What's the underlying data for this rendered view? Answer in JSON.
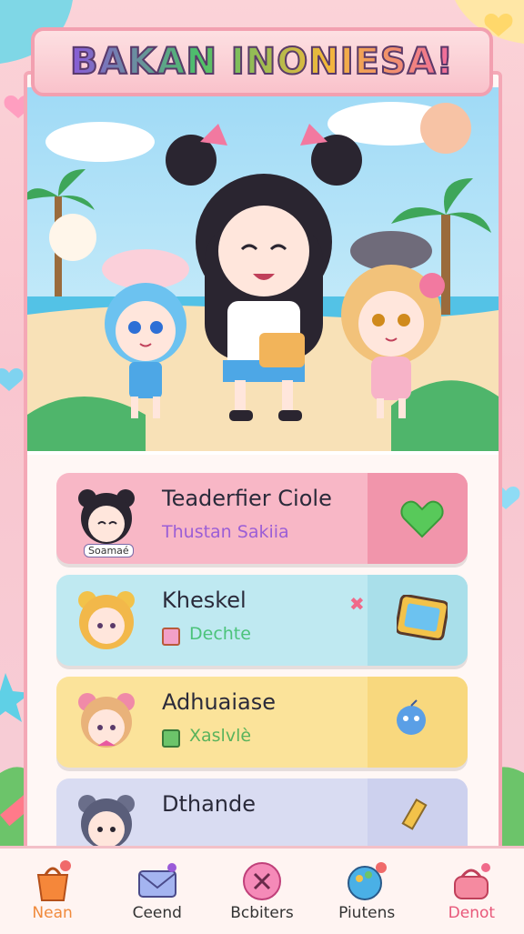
{
  "title": "BAKAN INONIESA!",
  "cards": [
    {
      "name": "Teaderfier Ciole",
      "sub": "Thustan Sakiia",
      "badge": "Soamaé",
      "bg": "#f8b7c6",
      "tail": "#f195ab",
      "sub_color": "#9b5ed6",
      "icon": "green-heart-icon"
    },
    {
      "name": "Kheskel",
      "sub": "Dechte",
      "bg": "#bfe9f1",
      "tail": "#a9dfea",
      "sub_color": "#4cc37a",
      "icon": "calendar-board-icon"
    },
    {
      "name": "Adhuaiase",
      "sub": "Xaslvlè",
      "bg": "#fbe39a",
      "tail": "#f8d87e",
      "sub_color": "#5ab35c",
      "icon": "blue-creature-icon"
    },
    {
      "name": "Dthande",
      "sub": "",
      "bg": "#d9dcf2",
      "tail": "#cdd1ee",
      "sub_color": "#6c6c9c",
      "icon": "pencil-icon"
    }
  ],
  "nav": [
    {
      "label": "Nean",
      "color": "#f08a3c",
      "icon": "shopping-bag-icon"
    },
    {
      "label": "Ceend",
      "color": "#333333",
      "icon": "envelope-icon"
    },
    {
      "label": "Bcbiters",
      "color": "#333333",
      "icon": "close-circle-icon"
    },
    {
      "label": "Piutens",
      "color": "#333333",
      "icon": "paint-palette-icon"
    },
    {
      "label": "Denot",
      "color": "#e8587a",
      "icon": "handbag-icon"
    }
  ]
}
